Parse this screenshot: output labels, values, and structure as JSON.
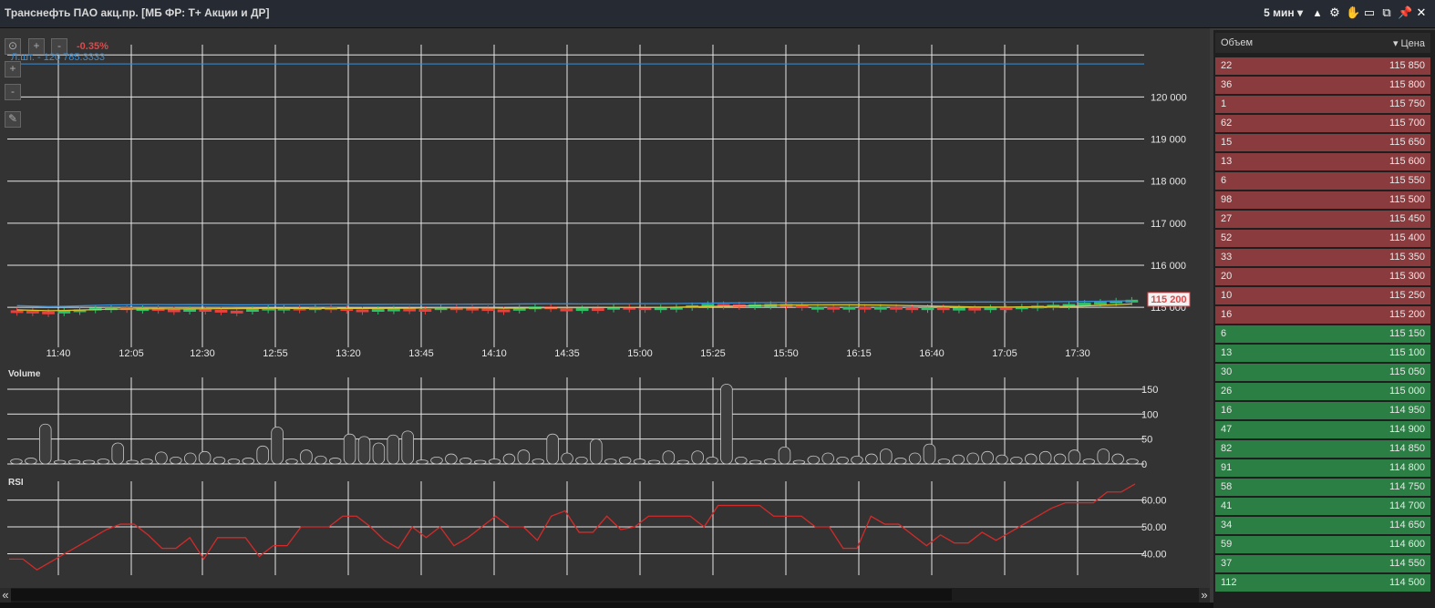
{
  "window": {
    "title": "Транснефть ПАО акц.пр. [МБ ФР: Т+ Акции и ДР]",
    "timeframe": "5 мин",
    "icons": [
      "chevron-up-icon",
      "gear-icon",
      "hand-icon",
      "layout-icon",
      "window-icon",
      "pin-icon",
      "close-icon"
    ]
  },
  "chart": {
    "change_pct": "-0.35%",
    "qty_label": "Л.шт. - 120 785.3333",
    "last_price_tag": "115 200",
    "zoom_buttons": [
      "⊙",
      "+",
      "-",
      "+",
      "-"
    ],
    "volume_label": "Volume",
    "rsi_label": "RSI",
    "colors": {
      "up": "#2ec36a",
      "down": "#e8413f",
      "ma_blue": "#3a8fd6",
      "ma_yellow": "#d9c22e",
      "rsi": "#d42a2a",
      "tag": "#e0484a"
    }
  },
  "chart_data": [
    {
      "type": "candlestick",
      "title": "",
      "x_ticks": [
        "11:40",
        "12:05",
        "12:30",
        "12:55",
        "13:20",
        "13:45",
        "14:10",
        "14:35",
        "15:00",
        "15:25",
        "15:50",
        "16:15",
        "16:40",
        "17:05",
        "17:30"
      ],
      "y_ticks": [
        "115 000",
        "116 000",
        "117 000",
        "118 000",
        "119 000",
        "120 000"
      ],
      "ylim": [
        114700,
        121200
      ],
      "horizontal_line": 120785,
      "closes": [
        114920,
        114900,
        114880,
        114920,
        114950,
        114990,
        115000,
        114960,
        114980,
        114950,
        114920,
        114960,
        114940,
        114920,
        114900,
        114960,
        114990,
        114990,
        114950,
        115000,
        114980,
        114950,
        114920,
        114960,
        114970,
        114960,
        114950,
        115000,
        114990,
        114980,
        114950,
        114920,
        114990,
        115020,
        114970,
        114960,
        114980,
        114960,
        115010,
        115000,
        114970,
        115000,
        115010,
        115050,
        115080,
        115070,
        115060,
        115070,
        115080,
        115050,
        115000,
        115010,
        114980,
        115010,
        114980,
        115010,
        115000,
        114970,
        115000,
        114950,
        114990,
        114960,
        115000,
        114990,
        115020,
        115040,
        115060,
        115080,
        115110,
        115130,
        115160,
        115180
      ]
    },
    {
      "type": "bar",
      "title": "Volume",
      "y_ticks": [
        "0",
        "50",
        "100",
        "150"
      ],
      "ylim": [
        0,
        170
      ],
      "values": [
        10,
        12,
        80,
        5,
        8,
        6,
        10,
        42,
        6,
        10,
        24,
        14,
        22,
        25,
        14,
        10,
        12,
        36,
        74,
        10,
        28,
        16,
        12,
        60,
        55,
        42,
        58,
        66,
        8,
        14,
        20,
        12,
        6,
        10,
        20,
        28,
        10,
        60,
        22,
        14,
        50,
        10,
        14,
        10,
        6,
        26,
        6,
        26,
        14,
        160,
        14,
        6,
        10,
        34,
        6,
        16,
        22,
        14,
        16,
        20,
        30,
        12,
        22,
        40,
        10,
        18,
        22,
        25,
        18,
        14,
        20,
        25,
        20,
        28,
        10,
        30,
        20,
        10
      ]
    },
    {
      "type": "line",
      "title": "RSI",
      "y_ticks": [
        "40.00",
        "50.00",
        "60.00"
      ],
      "ylim": [
        32,
        67
      ],
      "values": [
        38,
        38,
        34,
        37,
        40,
        43,
        46,
        49,
        51,
        51,
        47,
        42,
        42,
        46,
        38,
        46,
        46,
        46,
        39,
        43,
        43,
        50,
        50,
        50,
        54,
        54,
        50,
        45,
        42,
        50,
        46,
        50,
        43,
        46,
        50,
        54,
        50,
        50,
        45,
        54,
        56,
        48,
        48,
        54,
        49,
        50,
        54,
        54,
        54,
        54,
        50,
        58,
        58,
        58,
        58,
        54,
        54,
        54,
        50,
        50,
        42,
        42,
        54,
        51,
        51,
        47,
        43,
        47,
        44,
        44,
        48,
        45,
        48,
        51,
        54,
        57,
        59,
        59,
        59,
        63,
        63,
        66
      ]
    }
  ],
  "orderbook": {
    "header": {
      "volume": "Объем",
      "price": "Цена"
    },
    "rows": [
      {
        "side": "sell",
        "vol": "22",
        "price": "115 850"
      },
      {
        "side": "sell",
        "vol": "36",
        "price": "115 800"
      },
      {
        "side": "sell",
        "vol": "1",
        "price": "115 750"
      },
      {
        "side": "sell",
        "vol": "62",
        "price": "115 700"
      },
      {
        "side": "sell",
        "vol": "15",
        "price": "115 650"
      },
      {
        "side": "sell",
        "vol": "13",
        "price": "115 600"
      },
      {
        "side": "sell",
        "vol": "6",
        "price": "115 550"
      },
      {
        "side": "sell",
        "vol": "98",
        "price": "115 500"
      },
      {
        "side": "sell",
        "vol": "27",
        "price": "115 450"
      },
      {
        "side": "sell",
        "vol": "52",
        "price": "115 400"
      },
      {
        "side": "sell",
        "vol": "33",
        "price": "115 350"
      },
      {
        "side": "sell",
        "vol": "20",
        "price": "115 300"
      },
      {
        "side": "sell",
        "vol": "10",
        "price": "115 250"
      },
      {
        "side": "sell",
        "vol": "16",
        "price": "115 200"
      },
      {
        "side": "buy",
        "vol": "6",
        "price": "115 150"
      },
      {
        "side": "buy",
        "vol": "13",
        "price": "115 100"
      },
      {
        "side": "buy",
        "vol": "30",
        "price": "115 050"
      },
      {
        "side": "buy",
        "vol": "26",
        "price": "115 000"
      },
      {
        "side": "buy",
        "vol": "16",
        "price": "114 950"
      },
      {
        "side": "buy",
        "vol": "47",
        "price": "114 900"
      },
      {
        "side": "buy",
        "vol": "82",
        "price": "114 850"
      },
      {
        "side": "buy",
        "vol": "91",
        "price": "114 800"
      },
      {
        "side": "buy",
        "vol": "58",
        "price": "114 750"
      },
      {
        "side": "buy",
        "vol": "41",
        "price": "114 700"
      },
      {
        "side": "buy",
        "vol": "34",
        "price": "114 650"
      },
      {
        "side": "buy",
        "vol": "59",
        "price": "114 600"
      },
      {
        "side": "buy",
        "vol": "37",
        "price": "114 550"
      },
      {
        "side": "buy",
        "vol": "112",
        "price": "114 500"
      }
    ]
  },
  "scrollbar": {
    "left": "«",
    "right": "»"
  }
}
